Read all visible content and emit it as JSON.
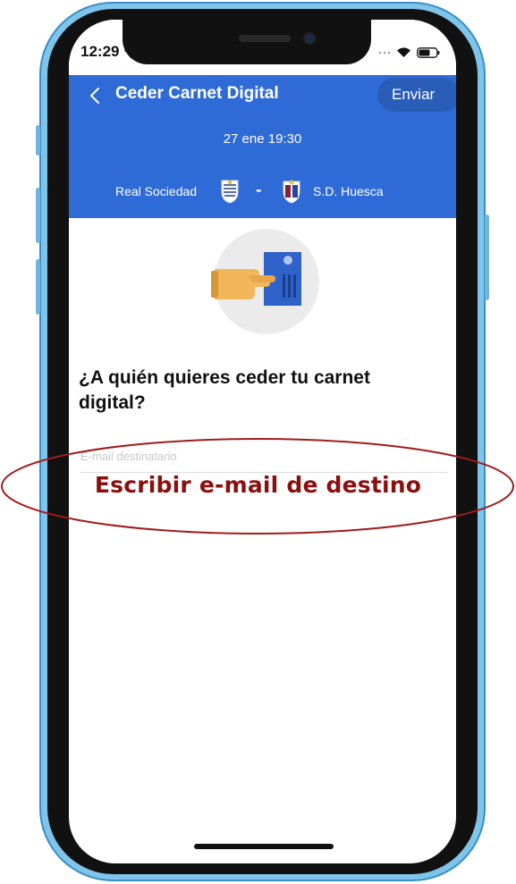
{
  "status_bar": {
    "time": "12:29",
    "icons": [
      "location-arrow-icon",
      "dots-icon",
      "wifi-icon",
      "battery-icon"
    ]
  },
  "header": {
    "title": "Ceder Carnet Digital",
    "send_label": "Enviar",
    "match": {
      "datetime": "27 ene 19:30",
      "home_team": "Real Sociedad",
      "away_team": "S.D. Huesca",
      "separator": "-"
    }
  },
  "content": {
    "question": "¿A quién quieres ceder tu carnet digital?",
    "email_field": {
      "label": "E-mail destinatario",
      "value": ""
    }
  },
  "annotation": {
    "text": "Escribir e-mail de destino",
    "color": "#8b0f0f"
  },
  "colors": {
    "header_blue": "#2f6bd6",
    "frame_blue": "#7fc4ea"
  }
}
